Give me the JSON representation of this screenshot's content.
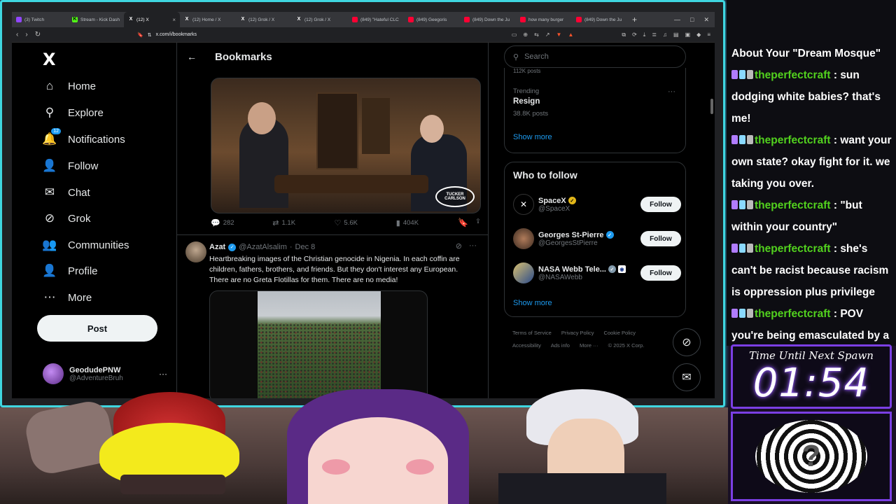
{
  "browser": {
    "tabs": [
      {
        "title": "(3) Twitch",
        "icon": "twitch",
        "active": false
      },
      {
        "title": "Stream - Kick Dash",
        "icon": "kick",
        "active": false
      },
      {
        "title": "(12) X",
        "icon": "x",
        "active": true
      },
      {
        "title": "(12) Home / X",
        "icon": "x",
        "active": false
      },
      {
        "title": "(12) Grok / X",
        "icon": "x",
        "active": false
      },
      {
        "title": "(12) Grok / X",
        "icon": "x",
        "active": false
      },
      {
        "title": "(849) \"Hateful CLC",
        "icon": "youtube",
        "active": false
      },
      {
        "title": "(849) Geegoris",
        "icon": "youtube",
        "active": false
      },
      {
        "title": "(849) Down the Ju",
        "icon": "youtube",
        "active": false
      },
      {
        "title": "how many burger",
        "icon": "youtube",
        "active": false
      },
      {
        "title": "(849) Down the Ju",
        "icon": "youtube",
        "active": false
      }
    ],
    "url": "x.com/i/bookmarks"
  },
  "nav": {
    "logo": "X",
    "items": [
      {
        "label": "Home",
        "icon": "home-icon",
        "glyph": "⌂"
      },
      {
        "label": "Explore",
        "icon": "search-icon",
        "glyph": "⚲"
      },
      {
        "label": "Notifications",
        "icon": "bell-icon",
        "glyph": "🔔",
        "badge": "12"
      },
      {
        "label": "Follow",
        "icon": "person-add-icon",
        "glyph": "👤"
      },
      {
        "label": "Chat",
        "icon": "mail-icon",
        "glyph": "✉"
      },
      {
        "label": "Grok",
        "icon": "grok-icon",
        "glyph": "⊘"
      },
      {
        "label": "Communities",
        "icon": "people-icon",
        "glyph": "👥"
      },
      {
        "label": "Profile",
        "icon": "profile-icon",
        "glyph": "👤"
      },
      {
        "label": "More",
        "icon": "more-circle-icon",
        "glyph": "⋯"
      }
    ],
    "post_label": "Post",
    "account": {
      "name": "GeodudePNW",
      "handle": "@AdventureBruh",
      "more": "···"
    }
  },
  "center": {
    "title": "Bookmarks",
    "video_logo": "TUCKER CARLSON",
    "actions": {
      "replies": "282",
      "reposts": "1.1K",
      "likes": "5.6K",
      "views": "404K"
    },
    "tweet": {
      "name": "Azat",
      "handle": "@AzatAlsalim",
      "sep": "·",
      "date": "Dec 8",
      "text": "Heartbreaking images of the Christian genocide in Nigenia. In each coffin are children, fathers, brothers, and friends. But they don't interest any European. There are no Greta Flotillas for them. There are no media!"
    }
  },
  "right": {
    "search_placeholder": "Search",
    "trending": {
      "prev_posts": "112K posts",
      "label": "Trending",
      "title": "Resign",
      "posts": "38.8K posts",
      "more": "···"
    },
    "show_more": "Show more",
    "wtf": {
      "title": "Who to follow",
      "accounts": [
        {
          "name": "SpaceX",
          "handle": "@SpaceX",
          "badge": "gold",
          "button": "Follow"
        },
        {
          "name": "Georges St-Pierre",
          "handle": "@GeorgesStPierre",
          "badge": "blue",
          "button": "Follow"
        },
        {
          "name": "NASA Webb Tele...",
          "handle": "@NASAWebb",
          "badge": "gray",
          "button": "Follow"
        }
      ],
      "show_more": "Show more"
    },
    "footer": [
      "Terms of Service",
      "Privacy Policy",
      "Cookie Policy",
      "Accessibility",
      "Ads info",
      "More ···",
      "© 2025 X Corp."
    ]
  },
  "chat": {
    "header": "About Your \"Dream Mosque\"",
    "messages": [
      {
        "user": "theperfectcraft",
        "text": "sun dodging white babies? that's me!"
      },
      {
        "user": "theperfectcraft",
        "text": "want your own state? okay fight for it. we taking you over."
      },
      {
        "user": "theperfectcraft",
        "text": "\"but within your country\""
      },
      {
        "user": "theperfectcraft",
        "text": "she's can't be racist because racism is oppression plus privilege"
      },
      {
        "user": "theperfectcraft",
        "text": "POV you're being emasculated by a black queen"
      }
    ]
  },
  "timer": {
    "label": "Time Until Next Spawn",
    "value": "01:54"
  }
}
